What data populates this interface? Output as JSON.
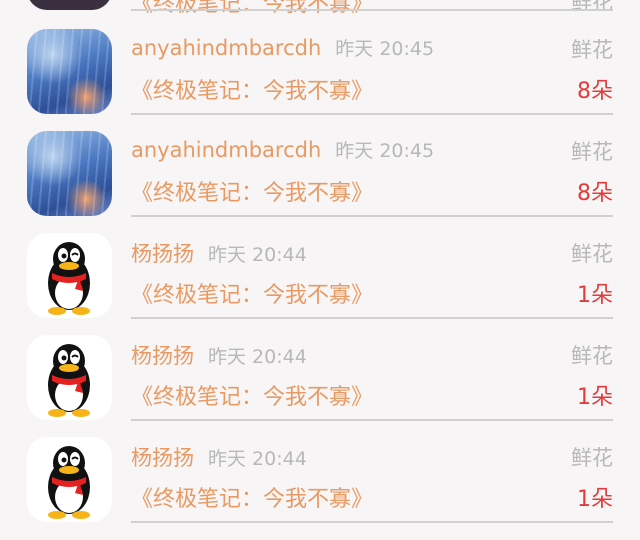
{
  "rows": [
    {
      "name": "anyahindmbarcdh",
      "time": "昨天 20:45",
      "book": "《终极笔记：今我不寡》",
      "gift": "鲜花",
      "count": "8朵",
      "avatar": "snow-photo"
    },
    {
      "name": "anyahindmbarcdh",
      "time": "昨天 20:45",
      "book": "《终极笔记：今我不寡》",
      "gift": "鲜花",
      "count": "8朵",
      "avatar": "snow-photo"
    },
    {
      "name": "杨扬扬",
      "time": "昨天 20:44",
      "book": "《终极笔记：今我不寡》",
      "gift": "鲜花",
      "count": "1朵",
      "avatar": "qq-penguin"
    },
    {
      "name": "杨扬扬",
      "time": "昨天 20:44",
      "book": "《终极笔记：今我不寡》",
      "gift": "鲜花",
      "count": "1朵",
      "avatar": "qq-penguin"
    },
    {
      "name": "杨扬扬",
      "time": "昨天 20:44",
      "book": "《终极笔记：今我不寡》",
      "gift": "鲜花",
      "count": "1朵",
      "avatar": "qq-penguin"
    }
  ],
  "partial_top": {
    "book": "《终极笔记：今我不寡》",
    "gift": "鲜花"
  },
  "colors": {
    "name": "#e89a64",
    "count": "#e03c3c",
    "muted": "#b8b8b8"
  }
}
